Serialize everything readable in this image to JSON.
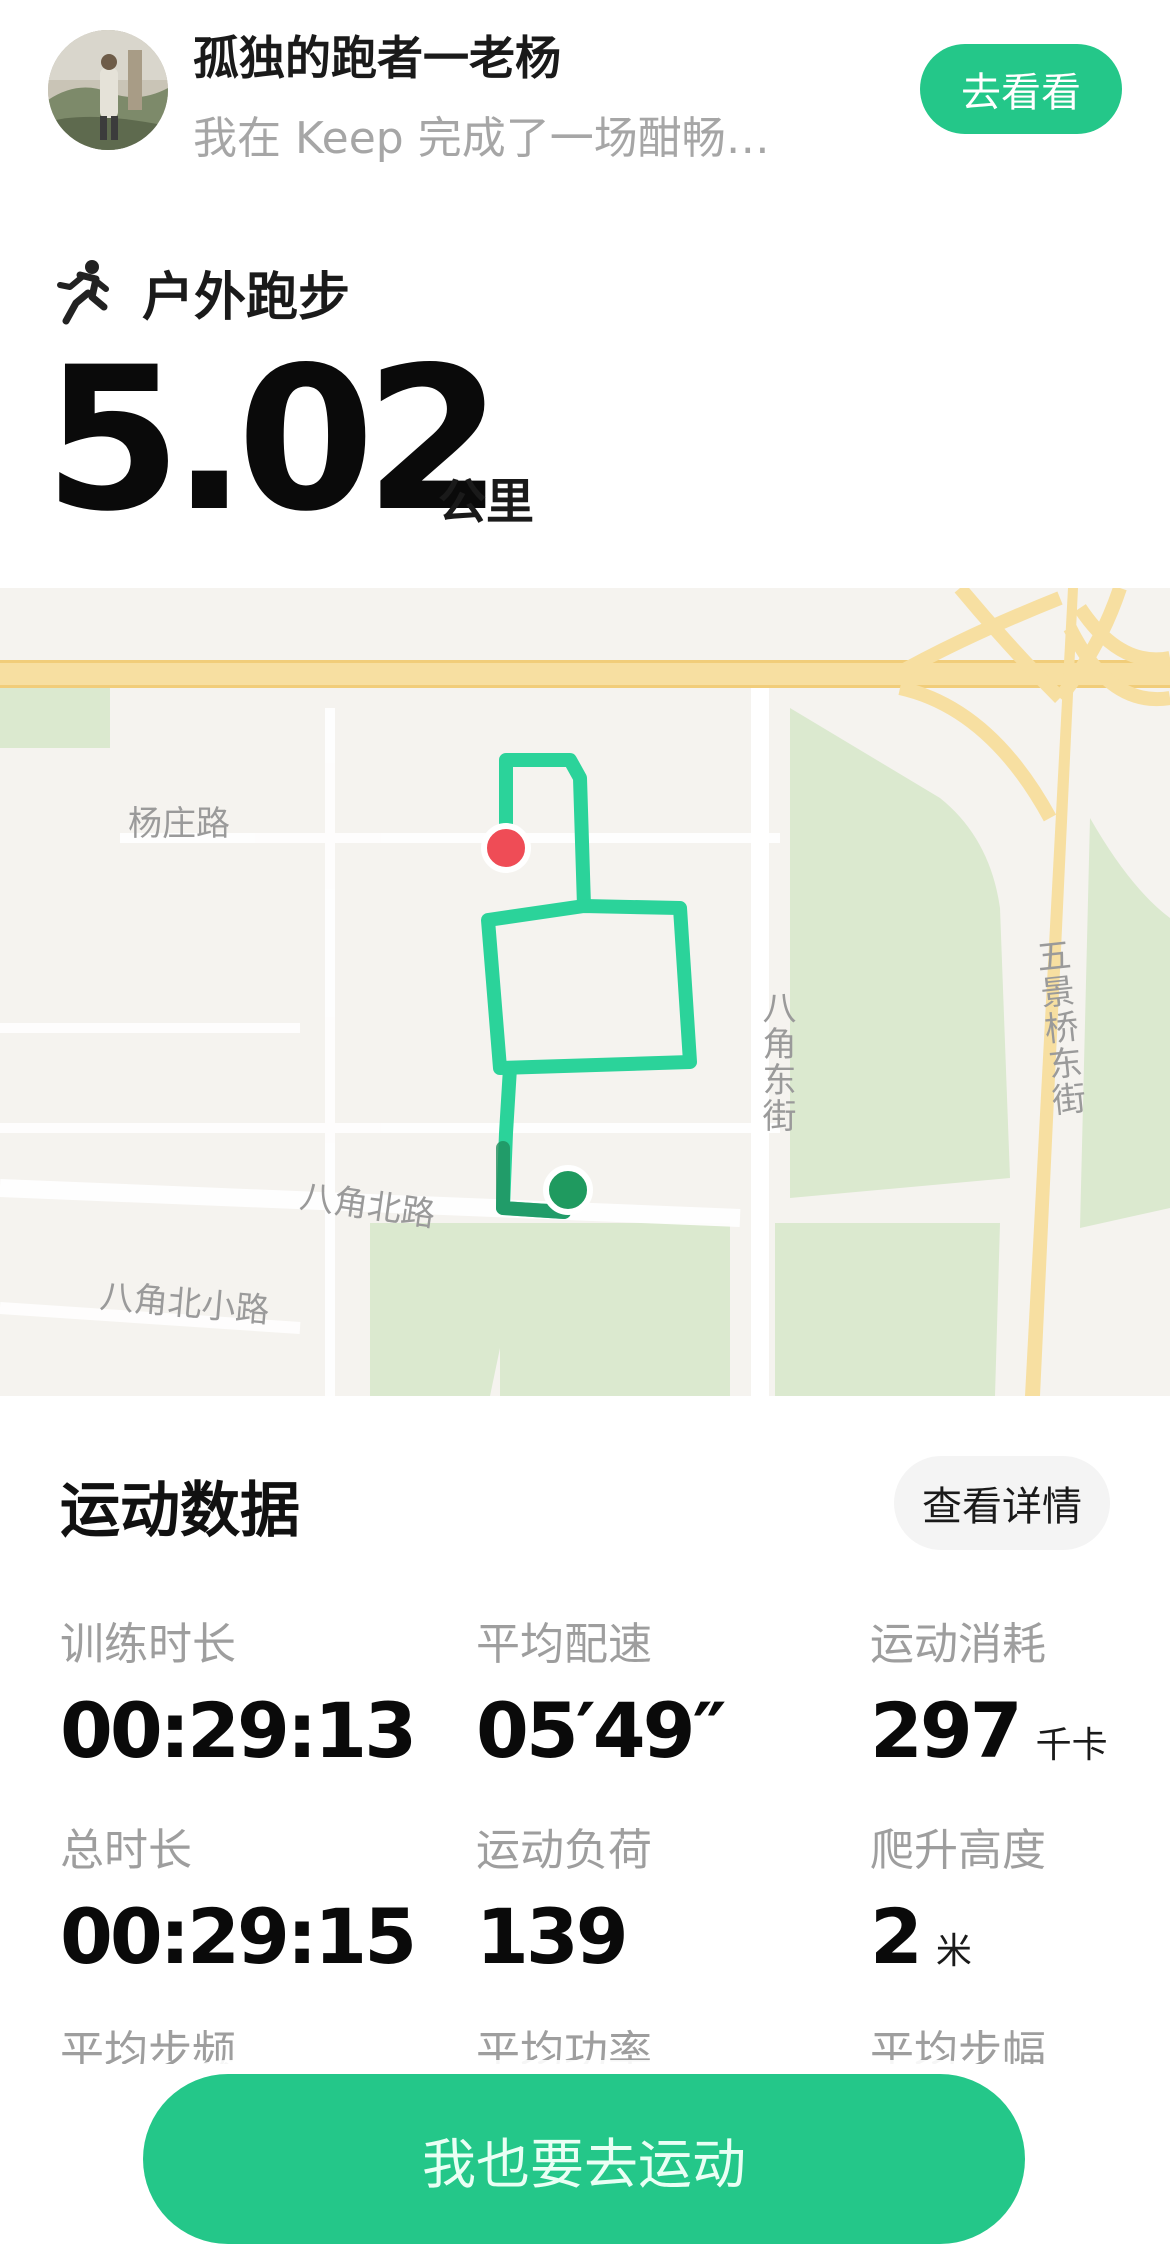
{
  "header": {
    "username": "孤独的跑者一老杨",
    "share_text": "我在 Keep 完成了一场酣畅…",
    "go_see_label": "去看看"
  },
  "activity": {
    "type_label": "户外跑步",
    "icon": "running-person-icon",
    "distance": "5.02",
    "distance_unit": "公里"
  },
  "map": {
    "labels": {
      "yangzhuang_road": "杨庄路",
      "bajiao_east_street": "八角东街",
      "wujingqiao_east_street": "五景桥东街",
      "bajiao_north_road": "八角北路",
      "bajiao_north_small_road": "八角北小路"
    },
    "start_marker_color": "#1f9a5f",
    "end_marker_color": "#ef4c56",
    "route_color": "#2bd39a"
  },
  "stats": {
    "section_title": "运动数据",
    "detail_label": "查看详情",
    "items": [
      {
        "label": "训练时长",
        "value": "00:29:13",
        "unit": ""
      },
      {
        "label": "平均配速",
        "value": "05′49″",
        "unit": ""
      },
      {
        "label": "运动消耗",
        "value": "297",
        "unit": "千卡"
      },
      {
        "label": "总时长",
        "value": "00:29:15",
        "unit": ""
      },
      {
        "label": "运动负荷",
        "value": "139",
        "unit": ""
      },
      {
        "label": "爬升高度",
        "value": "2",
        "unit": "米"
      },
      {
        "label": "平均步频",
        "value": "",
        "unit": ""
      },
      {
        "label": "平均功率",
        "value": "",
        "unit": ""
      },
      {
        "label": "平均步幅",
        "value": "",
        "unit": ""
      }
    ]
  },
  "cta": {
    "label": "我也要去运动"
  },
  "colors": {
    "accent": "#24c789",
    "map_bg": "#f5f3ef",
    "road_yellow": "#f7dfa1",
    "park_green": "#dbe9cf"
  }
}
